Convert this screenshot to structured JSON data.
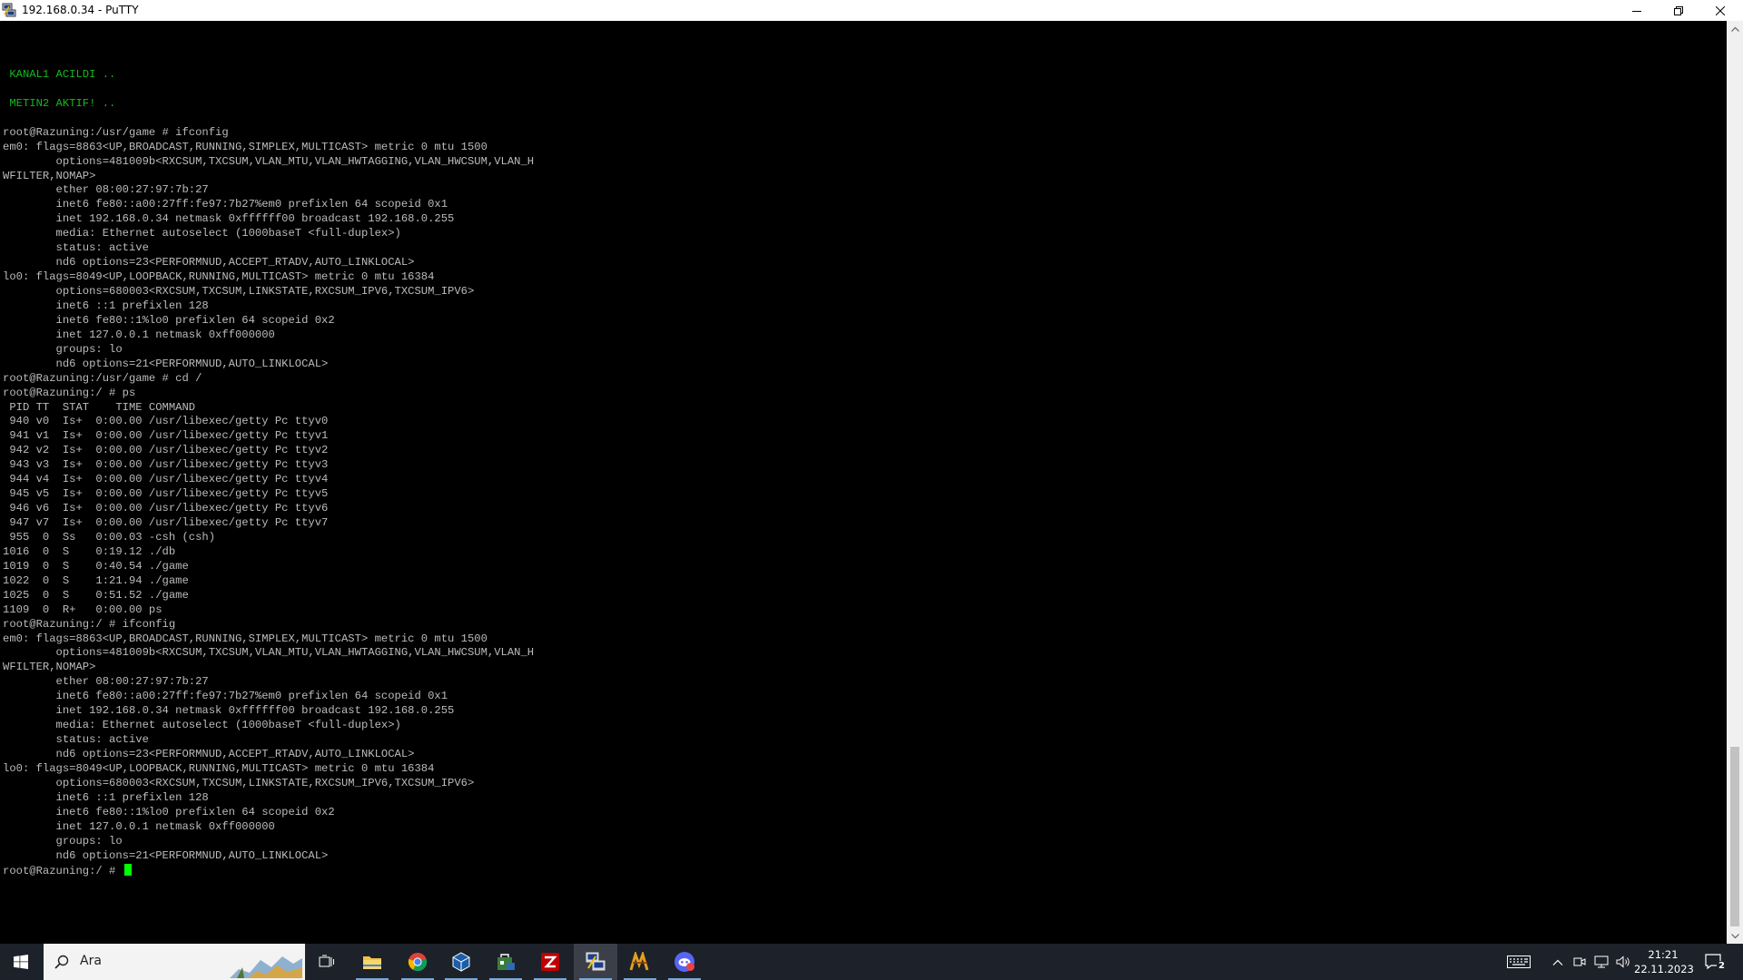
{
  "window": {
    "title": "192.168.0.34 - PuTTY",
    "icons": {
      "app": "putty-icon",
      "minimize": "minimize-icon",
      "maximize": "restore-icon",
      "close": "close-icon"
    }
  },
  "terminal": {
    "lines": [
      {
        "text": "",
        "color": "normal"
      },
      {
        "text": " KANAL1 ACILDI ..",
        "color": "green"
      },
      {
        "text": "",
        "color": "normal"
      },
      {
        "text": " METIN2 AKTIF! ..",
        "color": "green"
      },
      {
        "text": "",
        "color": "normal"
      },
      {
        "text": "root@Razuning:/usr/game # ifconfig",
        "color": "normal"
      },
      {
        "text": "em0: flags=8863<UP,BROADCAST,RUNNING,SIMPLEX,MULTICAST> metric 0 mtu 1500",
        "color": "normal"
      },
      {
        "text": "        options=481009b<RXCSUM,TXCSUM,VLAN_MTU,VLAN_HWTAGGING,VLAN_HWCSUM,VLAN_H",
        "color": "normal"
      },
      {
        "text": "WFILTER,NOMAP>",
        "color": "normal"
      },
      {
        "text": "        ether 08:00:27:97:7b:27",
        "color": "normal"
      },
      {
        "text": "        inet6 fe80::a00:27ff:fe97:7b27%em0 prefixlen 64 scopeid 0x1",
        "color": "normal"
      },
      {
        "text": "        inet 192.168.0.34 netmask 0xffffff00 broadcast 192.168.0.255",
        "color": "normal"
      },
      {
        "text": "        media: Ethernet autoselect (1000baseT <full-duplex>)",
        "color": "normal"
      },
      {
        "text": "        status: active",
        "color": "normal"
      },
      {
        "text": "        nd6 options=23<PERFORMNUD,ACCEPT_RTADV,AUTO_LINKLOCAL>",
        "color": "normal"
      },
      {
        "text": "lo0: flags=8049<UP,LOOPBACK,RUNNING,MULTICAST> metric 0 mtu 16384",
        "color": "normal"
      },
      {
        "text": "        options=680003<RXCSUM,TXCSUM,LINKSTATE,RXCSUM_IPV6,TXCSUM_IPV6>",
        "color": "normal"
      },
      {
        "text": "        inet6 ::1 prefixlen 128",
        "color": "normal"
      },
      {
        "text": "        inet6 fe80::1%lo0 prefixlen 64 scopeid 0x2",
        "color": "normal"
      },
      {
        "text": "        inet 127.0.0.1 netmask 0xff000000",
        "color": "normal"
      },
      {
        "text": "        groups: lo",
        "color": "normal"
      },
      {
        "text": "        nd6 options=21<PERFORMNUD,AUTO_LINKLOCAL>",
        "color": "normal"
      },
      {
        "text": "root@Razuning:/usr/game # cd /",
        "color": "normal"
      },
      {
        "text": "root@Razuning:/ # ps",
        "color": "normal"
      },
      {
        "text": " PID TT  STAT    TIME COMMAND",
        "color": "normal"
      },
      {
        "text": " 940 v0  Is+  0:00.00 /usr/libexec/getty Pc ttyv0",
        "color": "normal"
      },
      {
        "text": " 941 v1  Is+  0:00.00 /usr/libexec/getty Pc ttyv1",
        "color": "normal"
      },
      {
        "text": " 942 v2  Is+  0:00.00 /usr/libexec/getty Pc ttyv2",
        "color": "normal"
      },
      {
        "text": " 943 v3  Is+  0:00.00 /usr/libexec/getty Pc ttyv3",
        "color": "normal"
      },
      {
        "text": " 944 v4  Is+  0:00.00 /usr/libexec/getty Pc ttyv4",
        "color": "normal"
      },
      {
        "text": " 945 v5  Is+  0:00.00 /usr/libexec/getty Pc ttyv5",
        "color": "normal"
      },
      {
        "text": " 946 v6  Is+  0:00.00 /usr/libexec/getty Pc ttyv6",
        "color": "normal"
      },
      {
        "text": " 947 v7  Is+  0:00.00 /usr/libexec/getty Pc ttyv7",
        "color": "normal"
      },
      {
        "text": " 955  0  Ss   0:00.03 -csh (csh)",
        "color": "normal"
      },
      {
        "text": "1016  0  S    0:19.12 ./db",
        "color": "normal"
      },
      {
        "text": "1019  0  S    0:40.54 ./game",
        "color": "normal"
      },
      {
        "text": "1022  0  S    1:21.94 ./game",
        "color": "normal"
      },
      {
        "text": "1025  0  S    0:51.52 ./game",
        "color": "normal"
      },
      {
        "text": "1109  0  R+   0:00.00 ps",
        "color": "normal"
      },
      {
        "text": "root@Razuning:/ # ifconfig",
        "color": "normal"
      },
      {
        "text": "em0: flags=8863<UP,BROADCAST,RUNNING,SIMPLEX,MULTICAST> metric 0 mtu 1500",
        "color": "normal"
      },
      {
        "text": "        options=481009b<RXCSUM,TXCSUM,VLAN_MTU,VLAN_HWTAGGING,VLAN_HWCSUM,VLAN_H",
        "color": "normal"
      },
      {
        "text": "WFILTER,NOMAP>",
        "color": "normal"
      },
      {
        "text": "        ether 08:00:27:97:7b:27",
        "color": "normal"
      },
      {
        "text": "        inet6 fe80::a00:27ff:fe97:7b27%em0 prefixlen 64 scopeid 0x1",
        "color": "normal"
      },
      {
        "text": "        inet 192.168.0.34 netmask 0xffffff00 broadcast 192.168.0.255",
        "color": "normal"
      },
      {
        "text": "        media: Ethernet autoselect (1000baseT <full-duplex>)",
        "color": "normal"
      },
      {
        "text": "        status: active",
        "color": "normal"
      },
      {
        "text": "        nd6 options=23<PERFORMNUD,ACCEPT_RTADV,AUTO_LINKLOCAL>",
        "color": "normal"
      },
      {
        "text": "lo0: flags=8049<UP,LOOPBACK,RUNNING,MULTICAST> metric 0 mtu 16384",
        "color": "normal"
      },
      {
        "text": "        options=680003<RXCSUM,TXCSUM,LINKSTATE,RXCSUM_IPV6,TXCSUM_IPV6>",
        "color": "normal"
      },
      {
        "text": "        inet6 ::1 prefixlen 128",
        "color": "normal"
      },
      {
        "text": "        inet6 fe80::1%lo0 prefixlen 64 scopeid 0x2",
        "color": "normal"
      },
      {
        "text": "        inet 127.0.0.1 netmask 0xff000000",
        "color": "normal"
      },
      {
        "text": "        groups: lo",
        "color": "normal"
      },
      {
        "text": "        nd6 options=21<PERFORMNUD,AUTO_LINKLOCAL>",
        "color": "normal"
      }
    ],
    "prompt": "root@Razuning:/ # ",
    "colors": {
      "background": "#000000",
      "text": "#bbbbbb",
      "green": "#14b81c",
      "cursor": "#00ff00"
    }
  },
  "taskbar": {
    "search_placeholder": "Ara",
    "apps": [
      {
        "name": "task-view-icon"
      },
      {
        "name": "file-explorer-icon"
      },
      {
        "name": "chrome-icon"
      },
      {
        "name": "virtualbox-icon"
      },
      {
        "name": "store-icon"
      },
      {
        "name": "filezilla-icon"
      },
      {
        "name": "putty-icon",
        "active": true
      },
      {
        "name": "metin2-icon"
      },
      {
        "name": "discord-icon"
      }
    ],
    "tray_icons": [
      "keyboard-icon",
      "chevron-up-icon",
      "meet-now-icon",
      "network-icon",
      "volume-icon"
    ],
    "time": "21:21",
    "date": "22.11.2023",
    "notification_count": "2"
  }
}
